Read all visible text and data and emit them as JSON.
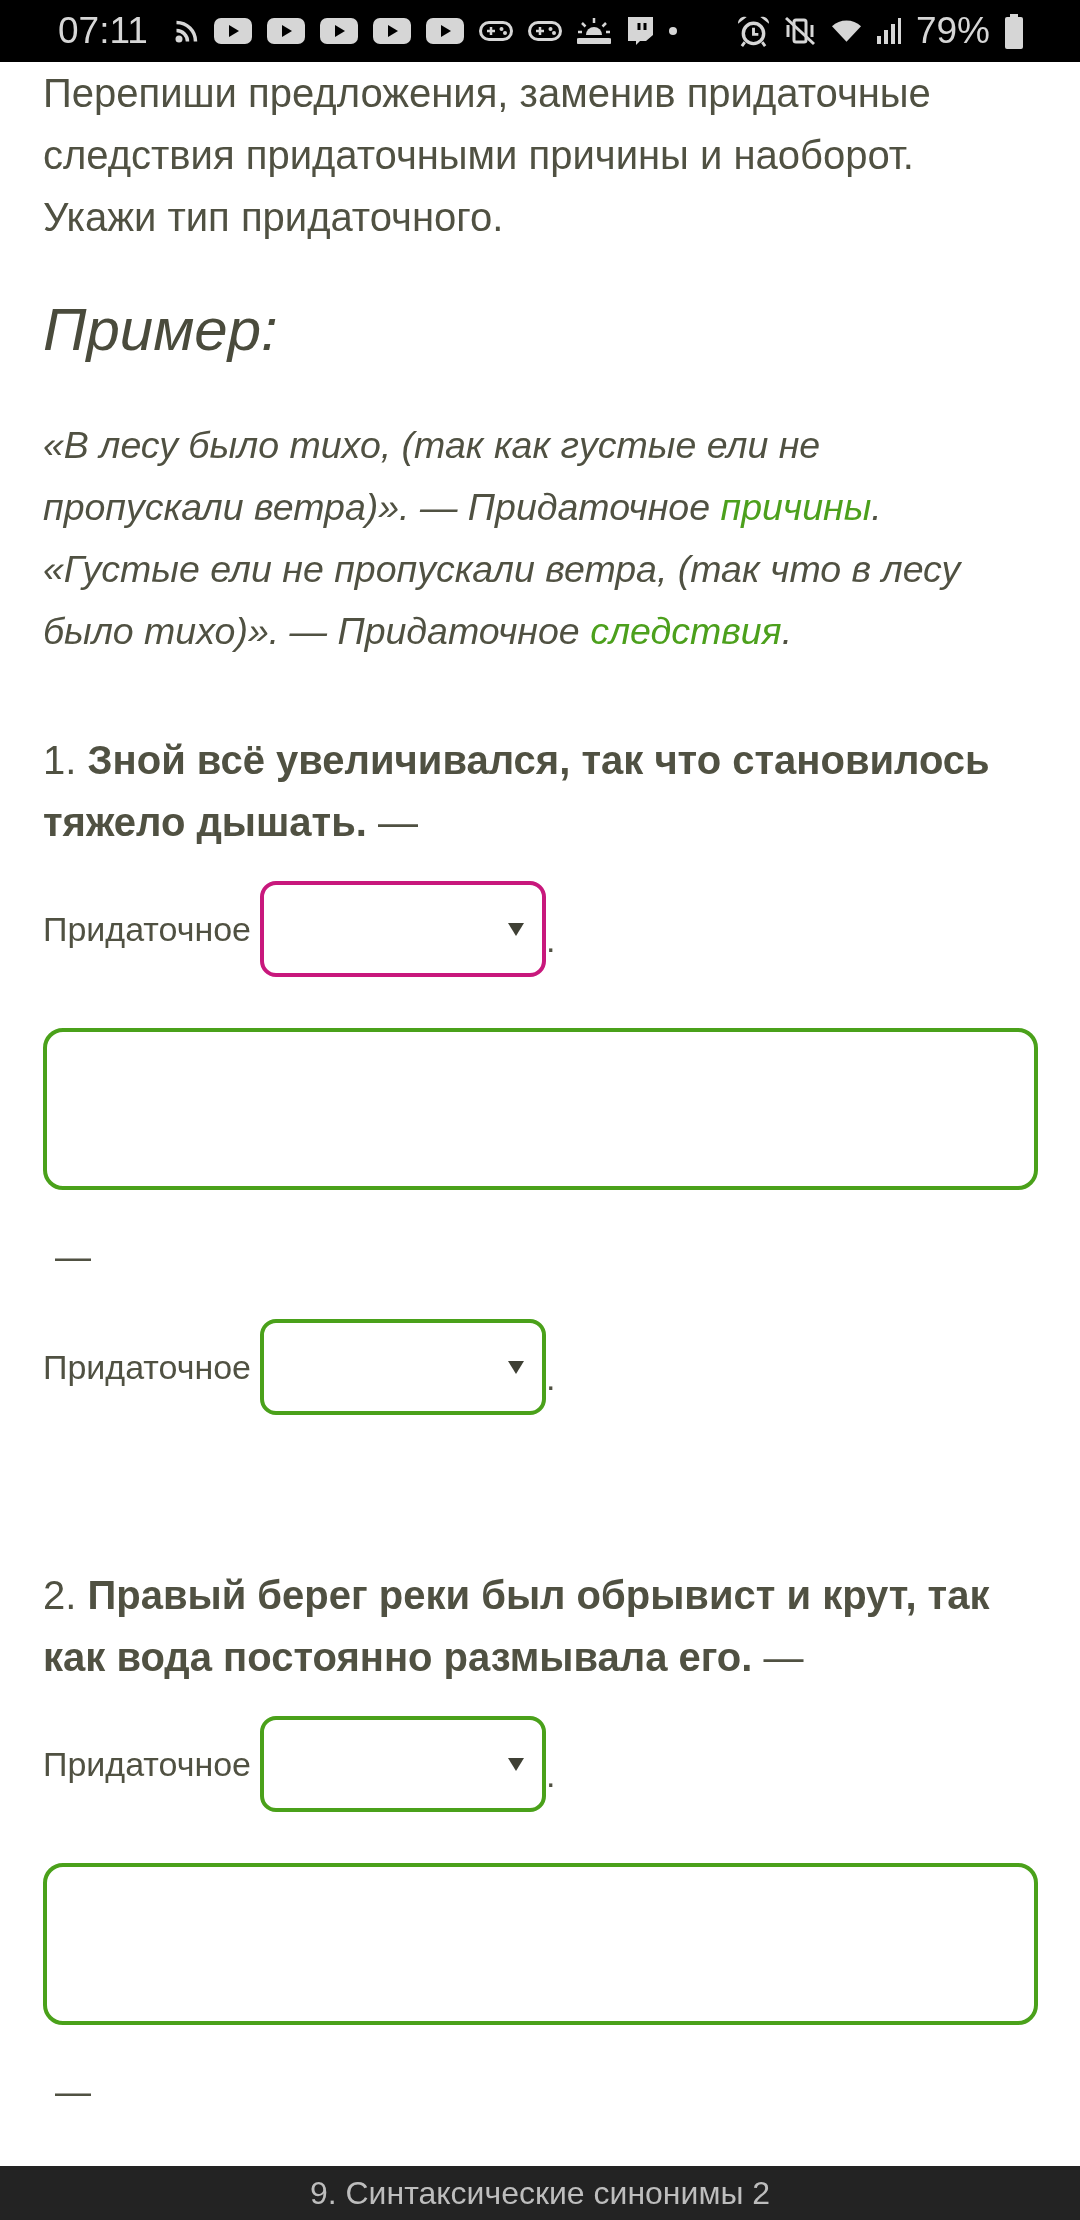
{
  "status_bar": {
    "time": "07:11",
    "battery": "79%"
  },
  "instructions": "Перепиши предложения, заменив придаточные следствия придаточными причины и наоборот. Укажи тип придаточного.",
  "example": {
    "title": "Пример:",
    "lines": [
      {
        "text": "«В лесу было тихо, (так как густые ели не пропускали ветра)».  — Придаточное",
        "answer": "причины",
        "end": "."
      },
      {
        "text": "«Густые ели не пропускали ветра, (так что в лесу было тихо)». — Придаточное",
        "answer": "следствия",
        "end": "."
      }
    ]
  },
  "tasks": [
    {
      "sentence": "1. **Зной всё увеличивался, так что становилось тяжело дышать.** —",
      "parts": [
        {
          "kind": "type_select",
          "label": "Придаточное",
          "focused": true,
          "end": "."
        },
        {
          "kind": "answer_box"
        },
        {
          "kind": "dash",
          "text": "—"
        },
        {
          "kind": "type_select",
          "label": "Придаточное",
          "focused": false,
          "end": "."
        }
      ]
    },
    {
      "sentence": "2. **Правый берег реки был обрывист и крут, так как вода постоянно размывала его.** —",
      "parts": [
        {
          "kind": "type_select",
          "label": "Придаточное",
          "focused": false,
          "end": "."
        },
        {
          "kind": "answer_box"
        },
        {
          "kind": "dash",
          "text": "—"
        }
      ]
    }
  ],
  "bottom_bar": {
    "title": "9. Синтаксические синонимы 2"
  }
}
